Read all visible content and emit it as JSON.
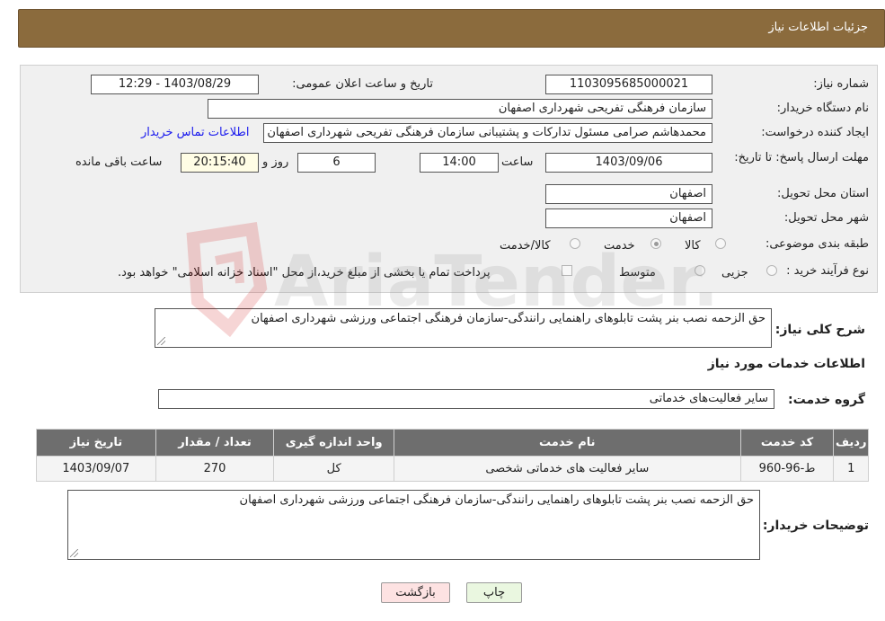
{
  "header": {
    "title": "جزئیات اطلاعات نیاز"
  },
  "form": {
    "need_number_label": "شماره نیاز:",
    "need_number": "1103095685000021",
    "announce_label": "تاریخ و ساعت اعلان عمومی:",
    "announce_value": "1403/08/29 - 12:29",
    "buyer_org_label": "نام دستگاه خریدار:",
    "buyer_org": "سازمان فرهنگی تفریحی شهرداری اصفهان",
    "creator_label": "ایجاد کننده درخواست:",
    "creator": "محمدهاشم صرامی مسئول تدارکات و پشتیبانی سازمان فرهنگی تفریحی شهرداری اصفهان",
    "contact_link": "اطلاعات تماس خریدار",
    "deadline_label": "مهلت ارسال پاسخ: تا تاریخ:",
    "deadline_date": "1403/09/06",
    "time_label": "ساعت",
    "deadline_time": "14:00",
    "days_value": "6",
    "days_label": "روز و",
    "remaining_time": "20:15:40",
    "remaining_label": "ساعت باقی مانده",
    "province_label": "استان محل تحویل:",
    "province": "اصفهان",
    "city_label": "شهر محل تحویل:",
    "city": "اصفهان",
    "category_label": "طبقه بندی موضوعی:",
    "category_options": [
      {
        "label": "کالا",
        "checked": false
      },
      {
        "label": "خدمت",
        "checked": true
      },
      {
        "label": "کالا/خدمت",
        "checked": false
      }
    ],
    "process_label": "نوع فرآیند خرید :",
    "process_options": [
      {
        "label": "جزیی",
        "checked": false
      },
      {
        "label": "متوسط",
        "checked": false
      }
    ],
    "payment_note": "پرداخت تمام یا بخشی از مبلغ خرید،از محل \"اسناد خزانه اسلامی\" خواهد بود."
  },
  "summary": {
    "label": "شرح کلی نیاز:",
    "value": "حق الزحمه نصب بنر پشت تابلوهای راهنمایی رانندگی-سازمان فرهنگی اجتماعی ورزشی شهرداری اصفهان"
  },
  "services": {
    "section_title": "اطلاعات خدمات مورد نیاز",
    "group_label": "گروه خدمت:",
    "group_value": "سایر فعالیت‌های خدماتی",
    "table": {
      "headers": [
        "ردیف",
        "کد خدمت",
        "نام خدمت",
        "واحد اندازه گیری",
        "تعداد / مقدار",
        "تاریخ نیاز"
      ],
      "rows": [
        [
          "1",
          "ط-96-960",
          "سایر فعالیت های خدماتی شخصی",
          "کل",
          "270",
          "1403/09/07"
        ]
      ]
    }
  },
  "buyer_notes": {
    "label": "توضیحات خریدار:",
    "value": "حق الزحمه نصب بنر پشت تابلوهای راهنمایی رانندگی-سازمان فرهنگی اجتماعی ورزشی شهرداری اصفهان"
  },
  "buttons": {
    "print": "چاپ",
    "back": "بازگشت"
  },
  "watermark": {
    "text": "AriaTender.neT"
  }
}
